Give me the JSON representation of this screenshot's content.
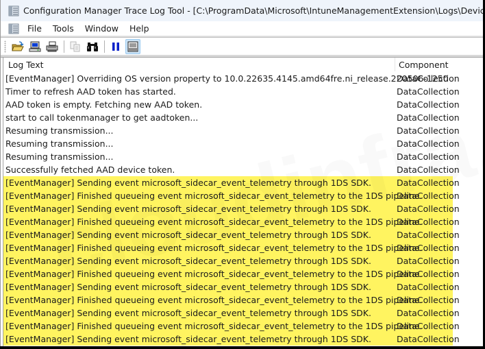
{
  "window": {
    "title": "Configuration Manager Trace Log Tool - [C:\\ProgramData\\Microsoft\\IntuneManagementExtension\\Logs\\DeviceHealthMonitoring"
  },
  "menu": {
    "items": [
      {
        "label": "File"
      },
      {
        "label": "Tools"
      },
      {
        "label": "Window"
      },
      {
        "label": "Help"
      }
    ]
  },
  "toolbar": {
    "buttons": [
      {
        "icon": "open-folder-icon"
      },
      {
        "icon": "computer-icon"
      },
      {
        "icon": "printer-icon"
      },
      {
        "icon": "copy-icon"
      },
      {
        "icon": "find-binoculars-icon"
      },
      {
        "icon": "pause-icon"
      },
      {
        "icon": "error-lookup-icon",
        "active": true
      }
    ]
  },
  "watermark": "cloudinfra.net",
  "columns": {
    "log_text": "Log Text",
    "component": "Component"
  },
  "colors": {
    "highlight": "#fff460"
  },
  "rows": [
    {
      "text": "[EventManager] Overriding OS version property to 10.0.22635.4145.amd64fre.ni_release.220506-1250",
      "component": "DataCollection",
      "highlighted": false
    },
    {
      "text": "Timer to refresh AAD token has started.",
      "component": "DataCollection",
      "highlighted": false
    },
    {
      "text": "AAD token is empty. Fetching new AAD token.",
      "component": "DataCollection",
      "highlighted": false
    },
    {
      "text": "start to call tokenmanager to get aadtoken...",
      "component": "DataCollection",
      "highlighted": false
    },
    {
      "text": "Resuming transmission...",
      "component": "DataCollection",
      "highlighted": false
    },
    {
      "text": "Resuming transmission...",
      "component": "DataCollection",
      "highlighted": false
    },
    {
      "text": "Resuming transmission...",
      "component": "DataCollection",
      "highlighted": false
    },
    {
      "text": "Successfully fetched AAD device token.",
      "component": "DataCollection",
      "highlighted": false
    },
    {
      "text": "[EventManager] Sending event microsoft_sidecar_event_telemetry through 1DS SDK.",
      "component": "DataCollection",
      "highlighted": true
    },
    {
      "text": "[EventManager] Finished queueing event microsoft_sidecar_event_telemetry to the 1DS pipeline.",
      "component": "DataCollection",
      "highlighted": true
    },
    {
      "text": "[EventManager] Sending event microsoft_sidecar_event_telemetry through 1DS SDK.",
      "component": "DataCollection",
      "highlighted": true
    },
    {
      "text": "[EventManager] Finished queueing event microsoft_sidecar_event_telemetry to the 1DS pipeline.",
      "component": "DataCollection",
      "highlighted": true
    },
    {
      "text": "[EventManager] Sending event microsoft_sidecar_event_telemetry through 1DS SDK.",
      "component": "DataCollection",
      "highlighted": true
    },
    {
      "text": "[EventManager] Finished queueing event microsoft_sidecar_event_telemetry to the 1DS pipeline.",
      "component": "DataCollection",
      "highlighted": true
    },
    {
      "text": "[EventManager] Sending event microsoft_sidecar_event_telemetry through 1DS SDK.",
      "component": "DataCollection",
      "highlighted": true
    },
    {
      "text": "[EventManager] Finished queueing event microsoft_sidecar_event_telemetry to the 1DS pipeline.",
      "component": "DataCollection",
      "highlighted": true
    },
    {
      "text": "[EventManager] Sending event microsoft_sidecar_event_telemetry through 1DS SDK.",
      "component": "DataCollection",
      "highlighted": true
    },
    {
      "text": "[EventManager] Finished queueing event microsoft_sidecar_event_telemetry to the 1DS pipeline.",
      "component": "DataCollection",
      "highlighted": true
    },
    {
      "text": "[EventManager] Sending event microsoft_sidecar_event_telemetry through 1DS SDK.",
      "component": "DataCollection",
      "highlighted": true
    },
    {
      "text": "[EventManager] Finished queueing event microsoft_sidecar_event_telemetry to the 1DS pipeline.",
      "component": "DataCollection",
      "highlighted": true
    },
    {
      "text": "[EventManager] Sending event microsoft_sidecar_event_telemetry through 1DS SDK.",
      "component": "DataCollection",
      "highlighted": true
    }
  ]
}
